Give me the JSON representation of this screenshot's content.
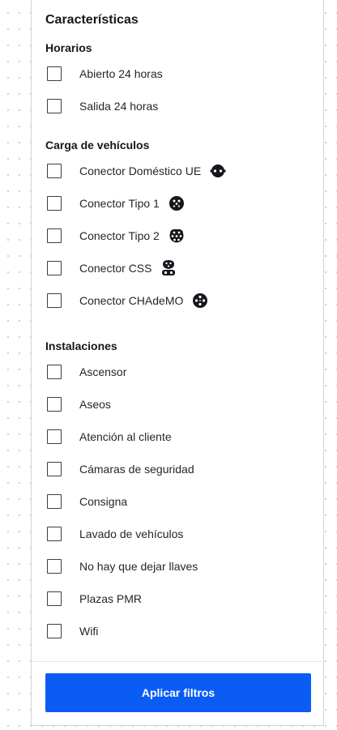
{
  "filters": {
    "title": "Características",
    "sections": {
      "horarios": {
        "title": "Horarios",
        "items": [
          "Abierto 24 horas",
          "Salida 24 horas"
        ]
      },
      "carga": {
        "title": "Carga de vehículos",
        "items": [
          {
            "label": "Conector Doméstico UE",
            "icon": "schuko-plug-icon"
          },
          {
            "label": "Conector Tipo 1",
            "icon": "type1-plug-icon"
          },
          {
            "label": "Conector Tipo 2",
            "icon": "type2-plug-icon"
          },
          {
            "label": "Conector CSS",
            "icon": "ccs-plug-icon"
          },
          {
            "label": "Conector CHAdeMO",
            "icon": "chademo-plug-icon"
          }
        ]
      },
      "instalaciones": {
        "title": "Instalaciones",
        "items": [
          "Ascensor",
          "Aseos",
          "Atención al cliente",
          "Cámaras de seguridad",
          "Consigna",
          "Lavado de vehículos",
          "No hay que dejar llaves",
          "Plazas PMR",
          "Wifi"
        ]
      }
    },
    "apply_label": "Aplicar filtros",
    "colors": {
      "accent": "#0a5cf5",
      "text": "#23262d",
      "border": "#cfd3da"
    }
  }
}
